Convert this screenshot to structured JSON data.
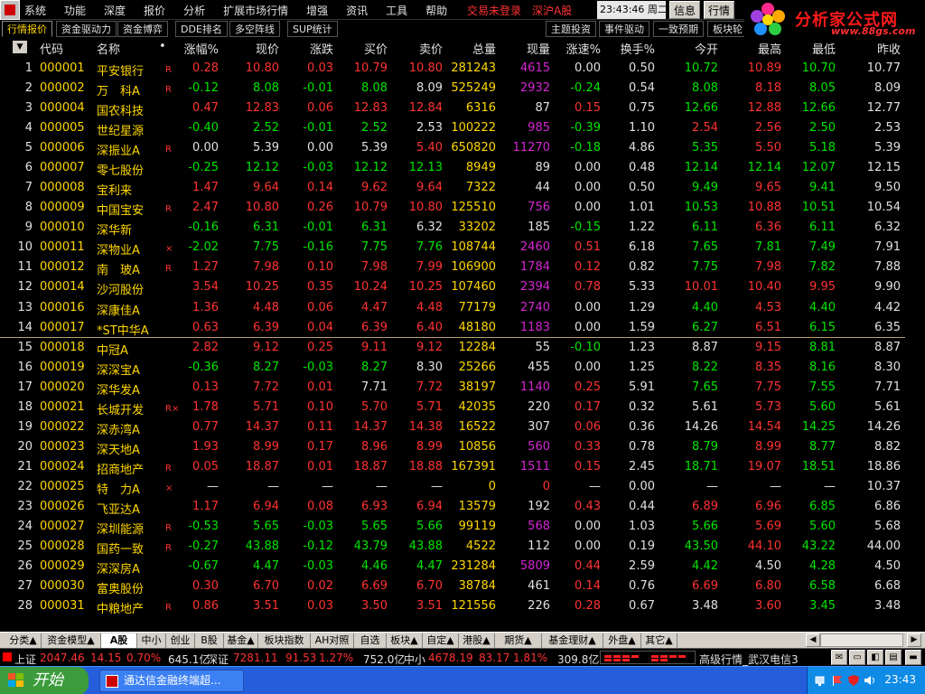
{
  "menu": {
    "items": [
      "系统",
      "功能",
      "深度",
      "报价",
      "分析",
      "扩展市场行情",
      "增强",
      "资讯",
      "工具",
      "帮助"
    ],
    "status": [
      "交易未登录",
      "深沪A股"
    ],
    "clock": "23:43:46 周二",
    "btn_info": "信息",
    "btn_quote": "行情"
  },
  "subtabs": [
    "行情报价",
    "资金驱动力",
    "资金博弈",
    "DDE排名",
    "多空阵线",
    "SUP统计",
    "主题投资",
    "事件驱动",
    "一致预期",
    "板块轮"
  ],
  "brand": {
    "name": "分析家公式网",
    "url": "www.88gs.com"
  },
  "header": {
    "sort": "▼",
    "code": "代码",
    "name": "名称",
    "dot": "•",
    "pct": "涨幅%",
    "now": "现价",
    "chg": "涨跌",
    "buy": "买价",
    "sell": "卖价",
    "vol": "总量",
    "cur": "现量",
    "spd": "涨速%",
    "turn": "换手%",
    "open": "今开",
    "high": "最高",
    "low": "最低",
    "prev": "昨收"
  },
  "rows": [
    {
      "i": "1",
      "code": "000001",
      "name": "平安银行",
      "flag": "R",
      "pct": "0.28",
      "now": "10.80",
      "chg": "0.03",
      "buy": "10.79",
      "sell": "10.80",
      "vol": "281243",
      "cur": "4615",
      "spd": "0.00",
      "turn": "0.50",
      "open": "10.72",
      "high": "10.89",
      "low": "10.70",
      "prev": "10.77"
    },
    {
      "i": "2",
      "code": "000002",
      "name": "万　科A",
      "flag": "R",
      "pct": "-0.12",
      "now": "8.08",
      "chg": "-0.01",
      "buy": "8.08",
      "sell": "8.09",
      "vol": "525249",
      "cur": "2932",
      "spd": "-0.24",
      "turn": "0.54",
      "open": "8.08",
      "high": "8.18",
      "low": "8.05",
      "prev": "8.09"
    },
    {
      "i": "3",
      "code": "000004",
      "name": "国农科技",
      "flag": "",
      "pct": "0.47",
      "now": "12.83",
      "chg": "0.06",
      "buy": "12.83",
      "sell": "12.84",
      "vol": "6316",
      "cur": "87",
      "spd": "0.15",
      "turn": "0.75",
      "open": "12.66",
      "high": "12.88",
      "low": "12.66",
      "prev": "12.77"
    },
    {
      "i": "4",
      "code": "000005",
      "name": "世纪星源",
      "flag": "",
      "pct": "-0.40",
      "now": "2.52",
      "chg": "-0.01",
      "buy": "2.52",
      "sell": "2.53",
      "vol": "100222",
      "cur": "985",
      "spd": "-0.39",
      "turn": "1.10",
      "open": "2.54",
      "high": "2.56",
      "low": "2.50",
      "prev": "2.53"
    },
    {
      "i": "5",
      "code": "000006",
      "name": "深振业A",
      "flag": "R",
      "pct": "0.00",
      "now": "5.39",
      "chg": "0.00",
      "buy": "5.39",
      "sell": "5.40",
      "vol": "650820",
      "cur": "11270",
      "spd": "-0.18",
      "turn": "4.86",
      "open": "5.35",
      "high": "5.50",
      "low": "5.18",
      "prev": "5.39"
    },
    {
      "i": "6",
      "code": "000007",
      "name": "零七股份",
      "flag": "",
      "pct": "-0.25",
      "now": "12.12",
      "chg": "-0.03",
      "buy": "12.12",
      "sell": "12.13",
      "vol": "8949",
      "cur": "89",
      "spd": "0.00",
      "turn": "0.48",
      "open": "12.14",
      "high": "12.14",
      "low": "12.07",
      "prev": "12.15"
    },
    {
      "i": "7",
      "code": "000008",
      "name": "宝利来",
      "flag": "",
      "pct": "1.47",
      "now": "9.64",
      "chg": "0.14",
      "buy": "9.62",
      "sell": "9.64",
      "vol": "7322",
      "cur": "44",
      "spd": "0.00",
      "turn": "0.50",
      "open": "9.49",
      "high": "9.65",
      "low": "9.41",
      "prev": "9.50"
    },
    {
      "i": "8",
      "code": "000009",
      "name": "中国宝安",
      "flag": "R",
      "pct": "2.47",
      "now": "10.80",
      "chg": "0.26",
      "buy": "10.79",
      "sell": "10.80",
      "vol": "125510",
      "cur": "756",
      "spd": "0.00",
      "turn": "1.01",
      "open": "10.53",
      "high": "10.88",
      "low": "10.51",
      "prev": "10.54"
    },
    {
      "i": "9",
      "code": "000010",
      "name": "深华新",
      "flag": "",
      "pct": "-0.16",
      "now": "6.31",
      "chg": "-0.01",
      "buy": "6.31",
      "sell": "6.32",
      "vol": "33202",
      "cur": "185",
      "spd": "-0.15",
      "turn": "1.22",
      "open": "6.11",
      "high": "6.36",
      "low": "6.11",
      "prev": "6.32"
    },
    {
      "i": "10",
      "code": "000011",
      "name": "深物业A",
      "flag": "×",
      "pct": "-2.02",
      "now": "7.75",
      "chg": "-0.16",
      "buy": "7.75",
      "sell": "7.76",
      "vol": "108744",
      "cur": "2460",
      "spd": "0.51",
      "turn": "6.18",
      "open": "7.65",
      "high": "7.81",
      "low": "7.49",
      "prev": "7.91"
    },
    {
      "i": "11",
      "code": "000012",
      "name": "南　玻A",
      "flag": "R",
      "pct": "1.27",
      "now": "7.98",
      "chg": "0.10",
      "buy": "7.98",
      "sell": "7.99",
      "vol": "106900",
      "cur": "1784",
      "spd": "0.12",
      "turn": "0.82",
      "open": "7.75",
      "high": "7.98",
      "low": "7.82",
      "prev": "7.88"
    },
    {
      "i": "12",
      "code": "000014",
      "name": "沙河股份",
      "flag": "",
      "pct": "3.54",
      "now": "10.25",
      "chg": "0.35",
      "buy": "10.24",
      "sell": "10.25",
      "vol": "107460",
      "cur": "2394",
      "spd": "0.78",
      "turn": "5.33",
      "open": "10.01",
      "high": "10.40",
      "low": "9.95",
      "prev": "9.90"
    },
    {
      "i": "13",
      "code": "000016",
      "name": "深康佳A",
      "flag": "",
      "pct": "1.36",
      "now": "4.48",
      "chg": "0.06",
      "buy": "4.47",
      "sell": "4.48",
      "vol": "77179",
      "cur": "2740",
      "spd": "0.00",
      "turn": "1.29",
      "open": "4.40",
      "high": "4.53",
      "low": "4.40",
      "prev": "4.42"
    },
    {
      "i": "14",
      "code": "000017",
      "name": "*ST中华A",
      "flag": "",
      "pct": "0.63",
      "now": "6.39",
      "chg": "0.04",
      "buy": "6.39",
      "sell": "6.40",
      "vol": "48180",
      "cur": "1183",
      "spd": "0.00",
      "turn": "1.59",
      "open": "6.27",
      "high": "6.51",
      "low": "6.15",
      "prev": "6.35"
    },
    {
      "i": "15",
      "code": "000018",
      "name": "中冠A",
      "flag": "",
      "pct": "2.82",
      "now": "9.12",
      "chg": "0.25",
      "buy": "9.11",
      "sell": "9.12",
      "vol": "12284",
      "cur": "55",
      "spd": "-0.10",
      "turn": "1.23",
      "open": "8.87",
      "high": "9.15",
      "low": "8.81",
      "prev": "8.87"
    },
    {
      "i": "16",
      "code": "000019",
      "name": "深深宝A",
      "flag": "",
      "pct": "-0.36",
      "now": "8.27",
      "chg": "-0.03",
      "buy": "8.27",
      "sell": "8.30",
      "vol": "25266",
      "cur": "455",
      "spd": "0.00",
      "turn": "1.25",
      "open": "8.22",
      "high": "8.35",
      "low": "8.16",
      "prev": "8.30"
    },
    {
      "i": "17",
      "code": "000020",
      "name": "深华发A",
      "flag": "",
      "pct": "0.13",
      "now": "7.72",
      "chg": "0.01",
      "buy": "7.71",
      "sell": "7.72",
      "vol": "38197",
      "cur": "1140",
      "spd": "0.25",
      "turn": "5.91",
      "open": "7.65",
      "high": "7.75",
      "low": "7.55",
      "prev": "7.71"
    },
    {
      "i": "18",
      "code": "000021",
      "name": "长城开发",
      "flag": "R×",
      "pct": "1.78",
      "now": "5.71",
      "chg": "0.10",
      "buy": "5.70",
      "sell": "5.71",
      "vol": "42035",
      "cur": "220",
      "spd": "0.17",
      "turn": "0.32",
      "open": "5.61",
      "high": "5.73",
      "low": "5.60",
      "prev": "5.61"
    },
    {
      "i": "19",
      "code": "000022",
      "name": "深赤湾A",
      "flag": "",
      "pct": "0.77",
      "now": "14.37",
      "chg": "0.11",
      "buy": "14.37",
      "sell": "14.38",
      "vol": "16522",
      "cur": "307",
      "spd": "0.06",
      "turn": "0.36",
      "open": "14.26",
      "high": "14.54",
      "low": "14.25",
      "prev": "14.26"
    },
    {
      "i": "20",
      "code": "000023",
      "name": "深天地A",
      "flag": "",
      "pct": "1.93",
      "now": "8.99",
      "chg": "0.17",
      "buy": "8.96",
      "sell": "8.99",
      "vol": "10856",
      "cur": "560",
      "spd": "0.33",
      "turn": "0.78",
      "open": "8.79",
      "high": "8.99",
      "low": "8.77",
      "prev": "8.82"
    },
    {
      "i": "21",
      "code": "000024",
      "name": "招商地产",
      "flag": "R",
      "pct": "0.05",
      "now": "18.87",
      "chg": "0.01",
      "buy": "18.87",
      "sell": "18.88",
      "vol": "167391",
      "cur": "1511",
      "spd": "0.15",
      "turn": "2.45",
      "open": "18.71",
      "high": "19.07",
      "low": "18.51",
      "prev": "18.86"
    },
    {
      "i": "22",
      "code": "000025",
      "name": "特　力A",
      "flag": "×",
      "pct": "—",
      "now": "—",
      "chg": "—",
      "buy": "—",
      "sell": "—",
      "vol": "0",
      "cur": "0",
      "spd": "—",
      "turn": "0.00",
      "open": "—",
      "high": "—",
      "low": "—",
      "prev": "10.37"
    },
    {
      "i": "23",
      "code": "000026",
      "name": "飞亚达A",
      "flag": "",
      "pct": "1.17",
      "now": "6.94",
      "chg": "0.08",
      "buy": "6.93",
      "sell": "6.94",
      "vol": "13579",
      "cur": "192",
      "spd": "0.43",
      "turn": "0.44",
      "open": "6.89",
      "high": "6.96",
      "low": "6.85",
      "prev": "6.86"
    },
    {
      "i": "24",
      "code": "000027",
      "name": "深圳能源",
      "flag": "R",
      "pct": "-0.53",
      "now": "5.65",
      "chg": "-0.03",
      "buy": "5.65",
      "sell": "5.66",
      "vol": "99119",
      "cur": "568",
      "spd": "0.00",
      "turn": "1.03",
      "open": "5.66",
      "high": "5.69",
      "low": "5.60",
      "prev": "5.68"
    },
    {
      "i": "25",
      "code": "000028",
      "name": "国药一致",
      "flag": "R",
      "pct": "-0.27",
      "now": "43.88",
      "chg": "-0.12",
      "buy": "43.79",
      "sell": "43.88",
      "vol": "4522",
      "cur": "112",
      "spd": "0.00",
      "turn": "0.19",
      "open": "43.50",
      "high": "44.10",
      "low": "43.22",
      "prev": "44.00"
    },
    {
      "i": "26",
      "code": "000029",
      "name": "深深房A",
      "flag": "",
      "pct": "-0.67",
      "now": "4.47",
      "chg": "-0.03",
      "buy": "4.46",
      "sell": "4.47",
      "vol": "231284",
      "cur": "5809",
      "spd": "0.44",
      "turn": "2.59",
      "open": "4.42",
      "high": "4.50",
      "low": "4.28",
      "prev": "4.50"
    },
    {
      "i": "27",
      "code": "000030",
      "name": "富奥股份",
      "flag": "",
      "pct": "0.30",
      "now": "6.70",
      "chg": "0.02",
      "buy": "6.69",
      "sell": "6.70",
      "vol": "38784",
      "cur": "461",
      "spd": "0.14",
      "turn": "0.76",
      "open": "6.69",
      "high": "6.80",
      "low": "6.58",
      "prev": "6.68"
    },
    {
      "i": "28",
      "code": "000031",
      "name": "中粮地产",
      "flag": "R",
      "pct": "0.86",
      "now": "3.51",
      "chg": "0.03",
      "buy": "3.50",
      "sell": "3.51",
      "vol": "121556",
      "cur": "226",
      "spd": "0.28",
      "turn": "0.67",
      "open": "3.48",
      "high": "3.60",
      "low": "3.45",
      "prev": "3.48"
    }
  ],
  "bottom_tabs": [
    "分类▲",
    "资金模型▲",
    "A股",
    "中小",
    "创业",
    "B股",
    "基金▲",
    "板块指数",
    "AH对照",
    "自选",
    "板块▲",
    "自定▲",
    "港股▲",
    "期货▲",
    "基金理财▲",
    "外盘▲",
    "其它▲"
  ],
  "index_bar": {
    "sh_label": "上证",
    "sh_val": "2047.46",
    "sh_chg": "14.15",
    "sh_pct": "0.70%",
    "sh_amt": "645.1亿",
    "sz_label": "深证",
    "sz_val": "7281.11",
    "sz_chg": "91.53",
    "sz_pct": "1.27%",
    "sz_amt": "752.0亿",
    "zx_label": "中小",
    "zx_val": "4678.19",
    "zx_chg": "83.17",
    "zx_pct": "1.81%",
    "zx_amt": "309.8亿",
    "server": "高级行情_武汉电信3"
  },
  "taskbar": {
    "start": "开始",
    "task": "通达信金融终端超...",
    "time": "23:43"
  },
  "colors": {
    "up": "#ff3232",
    "down": "#00e600",
    "code": "#ffd700",
    "volume": "#d426d4"
  }
}
